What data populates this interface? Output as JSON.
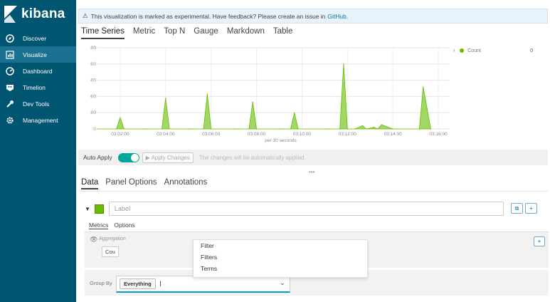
{
  "brand": {
    "name": "kibana"
  },
  "nav": [
    {
      "label": "Discover",
      "icon": "compass-icon"
    },
    {
      "label": "Visualize",
      "icon": "chart-icon"
    },
    {
      "label": "Dashboard",
      "icon": "dashboard-icon"
    },
    {
      "label": "Timelion",
      "icon": "timelion-icon"
    },
    {
      "label": "Dev Tools",
      "icon": "wrench-icon"
    },
    {
      "label": "Management",
      "icon": "gear-icon"
    }
  ],
  "banner": {
    "text": "This visualization is marked as experimental. Have feedback? Please create an issue in",
    "link": "GitHub",
    "suffix": "."
  },
  "viz_tabs": [
    "Time Series",
    "Metric",
    "Top N",
    "Gauge",
    "Markdown",
    "Table"
  ],
  "chart_data": {
    "type": "area",
    "xlabel": "per 10 seconds",
    "ylim": [
      0,
      2500
    ],
    "yticks": [
      "2,500",
      "2,000",
      "1,500",
      "1,000",
      "500",
      "0"
    ],
    "xticks": [
      "03:02:00",
      "03:04:00",
      "03:06:00",
      "03:08:00",
      "03:10:00",
      "03:12:00",
      "03:14:00",
      "03:16:00"
    ],
    "x": [
      "03:01:00",
      "03:01:50",
      "03:02:00",
      "03:02:10",
      "03:03:10",
      "03:03:50",
      "03:04:00",
      "03:04:10",
      "03:05:00",
      "03:05:40",
      "03:05:50",
      "03:06:00",
      "03:07:00",
      "03:07:40",
      "03:07:50",
      "03:08:00",
      "03:09:00",
      "03:09:30",
      "03:09:40",
      "03:09:50",
      "03:11:10",
      "03:11:40",
      "03:11:50",
      "03:12:00",
      "03:12:20",
      "03:12:40",
      "03:12:50",
      "03:13:10",
      "03:13:20",
      "03:13:30",
      "03:14:00",
      "03:15:10",
      "03:15:20",
      "03:15:40"
    ],
    "series": [
      {
        "name": "Count",
        "values": [
          0,
          0,
          350,
          0,
          0,
          0,
          950,
          0,
          0,
          0,
          1080,
          0,
          0,
          0,
          830,
          0,
          0,
          0,
          500,
          0,
          0,
          0,
          2000,
          0,
          0,
          100,
          0,
          50,
          0,
          130,
          0,
          0,
          1300,
          0
        ]
      }
    ],
    "legend": {
      "label": "Count",
      "value": "0",
      "position": "top-right"
    },
    "grid": true,
    "color": "#9fd864"
  },
  "controls": {
    "auto_apply_label": "Auto Apply",
    "apply_button": "▶ Apply Changes",
    "note": "The changes will be automatically applied."
  },
  "panel_tabs": [
    "Data",
    "Panel Options",
    "Annotations"
  ],
  "series_editor": {
    "label_placeholder": "Label",
    "swatch_color": "#68bc00"
  },
  "sub_tabs": [
    "Metrics",
    "Options"
  ],
  "aggregation": {
    "label": "Aggregation",
    "chip": "Cou"
  },
  "group_by": {
    "label": "Group By",
    "value": "Everything"
  },
  "dropdown_options": [
    "Filter",
    "Filters",
    "Terms"
  ]
}
